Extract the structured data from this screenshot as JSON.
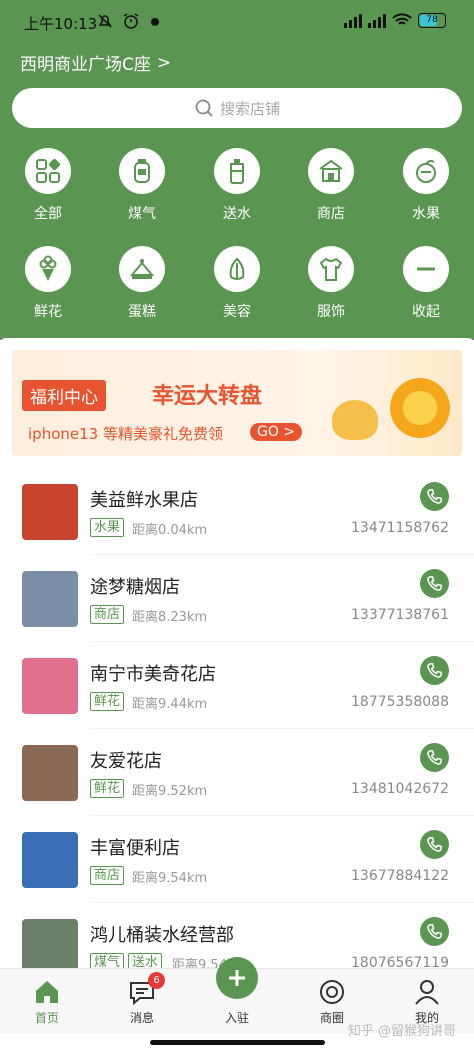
{
  "status": {
    "time": "上午10:13",
    "battery": "78"
  },
  "location": {
    "name": "西明商业广场C座",
    "arrow": ">"
  },
  "search": {
    "placeholder": "搜索店铺"
  },
  "categories": [
    {
      "label": "全部",
      "icon": "grid-icon"
    },
    {
      "label": "煤气",
      "icon": "gas-tank-icon"
    },
    {
      "label": "送水",
      "icon": "water-bucket-icon"
    },
    {
      "label": "商店",
      "icon": "shop-icon"
    },
    {
      "label": "水果",
      "icon": "fruit-icon"
    },
    {
      "label": "鲜花",
      "icon": "flower-icon"
    },
    {
      "label": "蛋糕",
      "icon": "cake-icon"
    },
    {
      "label": "美容",
      "icon": "beauty-icon"
    },
    {
      "label": "服饰",
      "icon": "clothes-icon"
    },
    {
      "label": "收起",
      "icon": "collapse-icon"
    }
  ],
  "banner": {
    "tag": "福利中心",
    "title": "幸运大转盘",
    "subtitle": "iphone13 等精美豪礼免费领",
    "go": "GO >"
  },
  "stores": [
    {
      "name": "美益鲜水果店",
      "tags": [
        "水果"
      ],
      "distance": "距离0.04km",
      "phone": "13471158762",
      "thumb_color": "#c7452f"
    },
    {
      "name": "途梦糖烟店",
      "tags": [
        "商店"
      ],
      "distance": "距离8.23km",
      "phone": "13377138761",
      "thumb_color": "#7a8fa5"
    },
    {
      "name": "南宁市美奇花店",
      "tags": [
        "鲜花"
      ],
      "distance": "距离9.44km",
      "phone": "18775358088",
      "thumb_color": "#e0708e"
    },
    {
      "name": "友爱花店",
      "tags": [
        "鲜花"
      ],
      "distance": "距离9.52km",
      "phone": "13481042672",
      "thumb_color": "#8a6a55"
    },
    {
      "name": "丰富便利店",
      "tags": [
        "商店"
      ],
      "distance": "距离9.54km",
      "phone": "13677884122",
      "thumb_color": "#3a6fb5"
    },
    {
      "name": "鸿儿桶装水经营部",
      "tags": [
        "煤气",
        "送水"
      ],
      "distance": "距离9.54km",
      "phone": "18076567119",
      "thumb_color": "#6b7f6a"
    }
  ],
  "nav": [
    {
      "label": "首页",
      "icon": "home-icon"
    },
    {
      "label": "消息",
      "icon": "message-icon",
      "count": "6"
    },
    {
      "label": "入驻",
      "icon": "plus-icon"
    },
    {
      "label": "商圈",
      "icon": "circle-icon"
    },
    {
      "label": "我的",
      "icon": "user-icon"
    }
  ],
  "watermark": "知乎 @留猴狗讲哥",
  "colors": {
    "primary": "#5b9552",
    "accent": "#e8542f"
  }
}
